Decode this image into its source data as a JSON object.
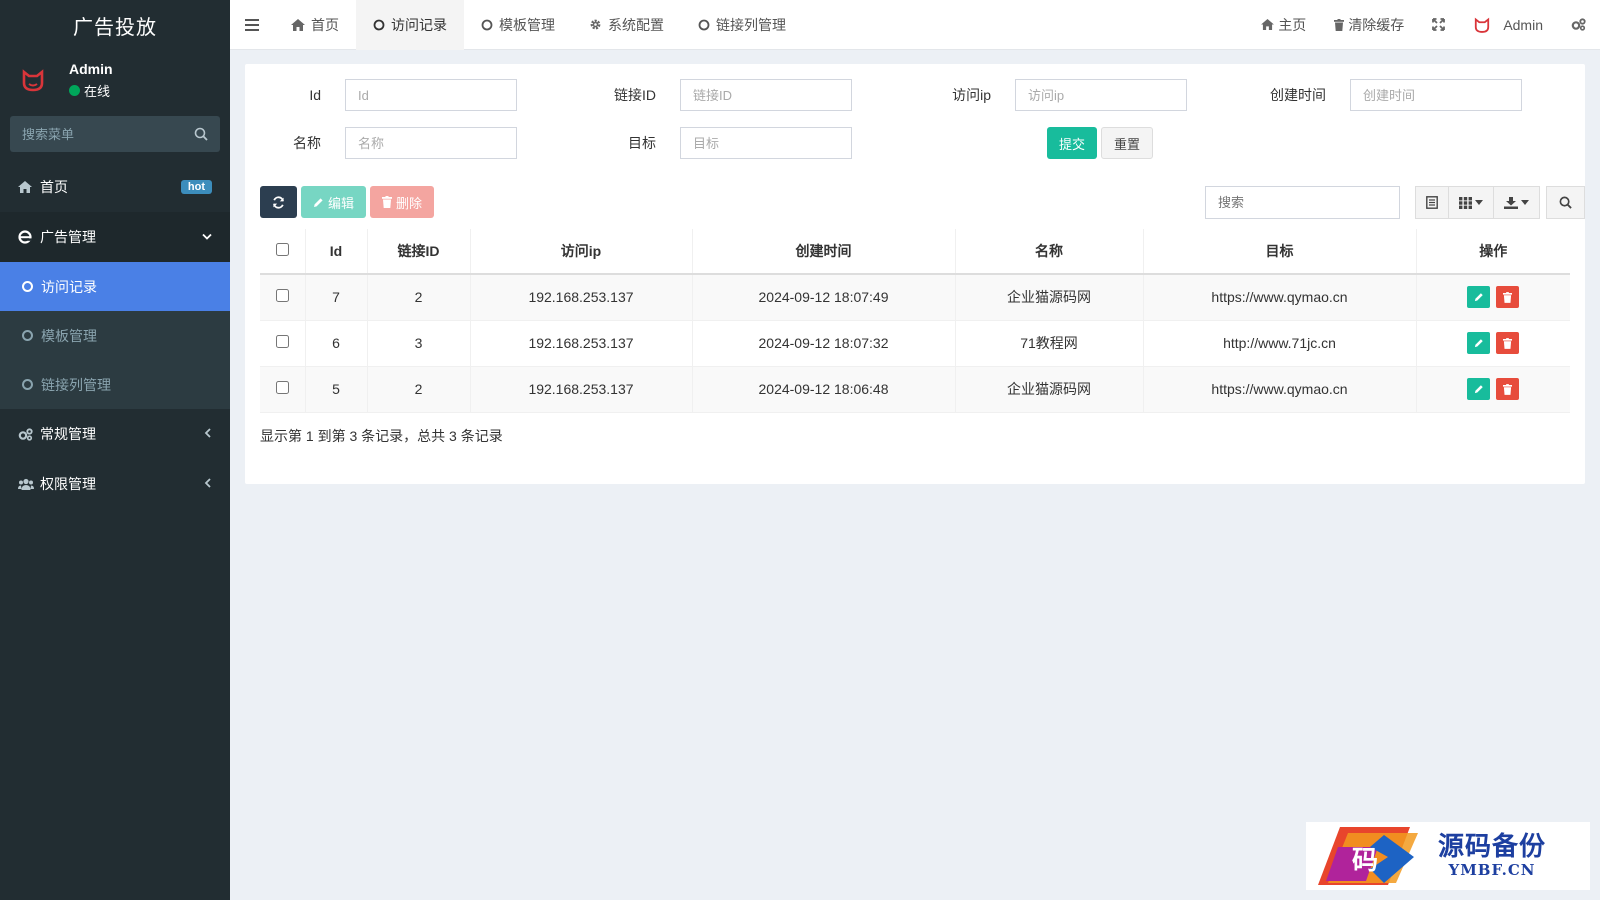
{
  "sidebar": {
    "logo": "广告投放",
    "user": {
      "name": "Admin",
      "status": "在线"
    },
    "search_placeholder": "搜索菜单",
    "menu": {
      "home": {
        "label": "首页",
        "badge": "hot"
      },
      "ad": {
        "label": "广告管理"
      },
      "sub": [
        {
          "label": "访问记录"
        },
        {
          "label": "模板管理"
        },
        {
          "label": "链接列管理"
        }
      ],
      "general": {
        "label": "常规管理"
      },
      "perm": {
        "label": "权限管理"
      }
    }
  },
  "topbar": {
    "tabs": [
      {
        "label": "首页"
      },
      {
        "label": "访问记录"
      },
      {
        "label": "模板管理"
      },
      {
        "label": "系统配置"
      },
      {
        "label": "链接列管理"
      }
    ],
    "right": {
      "home": "主页",
      "clear_cache": "清除缓存",
      "admin": "Admin"
    }
  },
  "filter": {
    "id": {
      "label": "Id",
      "placeholder": "Id"
    },
    "link_id": {
      "label": "链接ID",
      "placeholder": "链接ID"
    },
    "ip": {
      "label": "访问ip",
      "placeholder": "访问ip"
    },
    "created": {
      "label": "创建时间",
      "placeholder": "创建时间"
    },
    "name": {
      "label": "名称",
      "placeholder": "名称"
    },
    "target": {
      "label": "目标",
      "placeholder": "目标"
    },
    "submit": "提交",
    "reset": "重置"
  },
  "toolbar": {
    "edit": "编辑",
    "delete": "删除",
    "search_placeholder": "搜索"
  },
  "table": {
    "headers": [
      "Id",
      "链接ID",
      "访问ip",
      "创建时间",
      "名称",
      "目标",
      "操作"
    ],
    "rows": [
      {
        "id": "7",
        "link_id": "2",
        "ip": "192.168.253.137",
        "created": "2024-09-12 18:07:49",
        "name": "企业猫源码网",
        "target": "https://www.qymao.cn"
      },
      {
        "id": "6",
        "link_id": "3",
        "ip": "192.168.253.137",
        "created": "2024-09-12 18:07:32",
        "name": "71教程网",
        "target": "http://www.71jc.cn"
      },
      {
        "id": "5",
        "link_id": "2",
        "ip": "192.168.253.137",
        "created": "2024-09-12 18:06:48",
        "name": "企业猫源码网",
        "target": "https://www.qymao.cn"
      }
    ]
  },
  "summary": "显示第 1 到第 3 条记录，总共 3 条记录",
  "watermark": {
    "logo_char": "码",
    "cn": "源码备份",
    "en": "YMBF.CN"
  },
  "colors": {
    "sidebar": "#222d32",
    "active_sub": "#4a80e6",
    "success": "#18bc9c",
    "danger": "#e74c3c",
    "refresh": "#2c3e50"
  }
}
